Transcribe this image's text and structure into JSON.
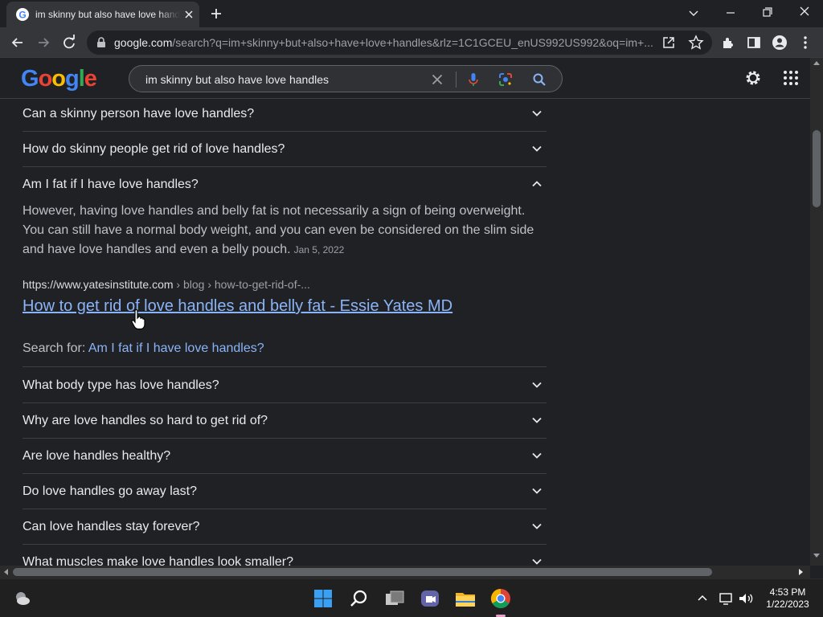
{
  "browser": {
    "tab_title": "im skinny but also have love handles - Google Search",
    "url_host": "google.com",
    "url_path": "/search?q=im+skinny+but+also+have+love+handles&rlz=1C1GCEU_enUS992US992&oq=im+..."
  },
  "search": {
    "logo": [
      "G",
      "o",
      "o",
      "g",
      "l",
      "e"
    ],
    "query": "im skinny but also have love handles"
  },
  "paa": {
    "top_questions": [
      "Can a skinny person have love handles?",
      "How do skinny people get rid of love handles?",
      "Am I fat if I have love handles?"
    ],
    "answer": {
      "text": "However, having love handles and belly fat is not necessarily a sign of being overweight. You can still have a normal body weight, and you can even be considered on the slim side and have love handles and even a belly pouch.",
      "date": "Jan 5, 2022",
      "cite_host": "https://www.yatesinstitute.com",
      "cite_path": " › blog › how-to-get-rid-of-...",
      "link_title": "How to get rid of love handles and belly fat - Essie Yates MD",
      "search_for_label": "Search for: ",
      "search_for_query": "Am I fat if I have love handles?"
    },
    "more_questions": [
      "What body type has love handles?",
      "Why are love handles so hard to get rid of?",
      "Are love handles healthy?",
      "Do love handles go away last?",
      "Can love handles stay forever?",
      "What muscles make love handles look smaller?"
    ]
  },
  "taskbar": {
    "time": "4:53 PM",
    "date": "1/22/2023",
    "icons": [
      "weather-icon",
      "start-icon",
      "search-icon",
      "task-view-icon",
      "teams-chat-icon",
      "file-explorer-icon",
      "chrome-icon"
    ]
  },
  "colors": {
    "page_bg": "#202124",
    "link": "#8ab4f8",
    "text": "#e8eaed",
    "muted": "#9aa0a6"
  }
}
